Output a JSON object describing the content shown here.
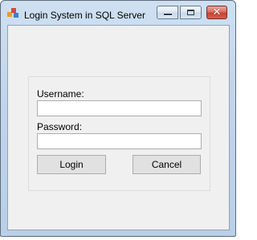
{
  "window": {
    "title": "Login System in SQL Server",
    "caption_buttons": {
      "minimize_icon": "minimize-icon",
      "maximize_icon": "maximize-icon",
      "close_icon": "close-icon",
      "close_glyph": "✕"
    }
  },
  "form": {
    "username_label": "Username:",
    "username_value": "",
    "password_label": "Password:",
    "password_value": "",
    "login_button": "Login",
    "cancel_button": "Cancel"
  },
  "colors": {
    "client_background": "#f0f0f0",
    "button_face": "#e1e1e1",
    "close_button": "#c44531"
  }
}
